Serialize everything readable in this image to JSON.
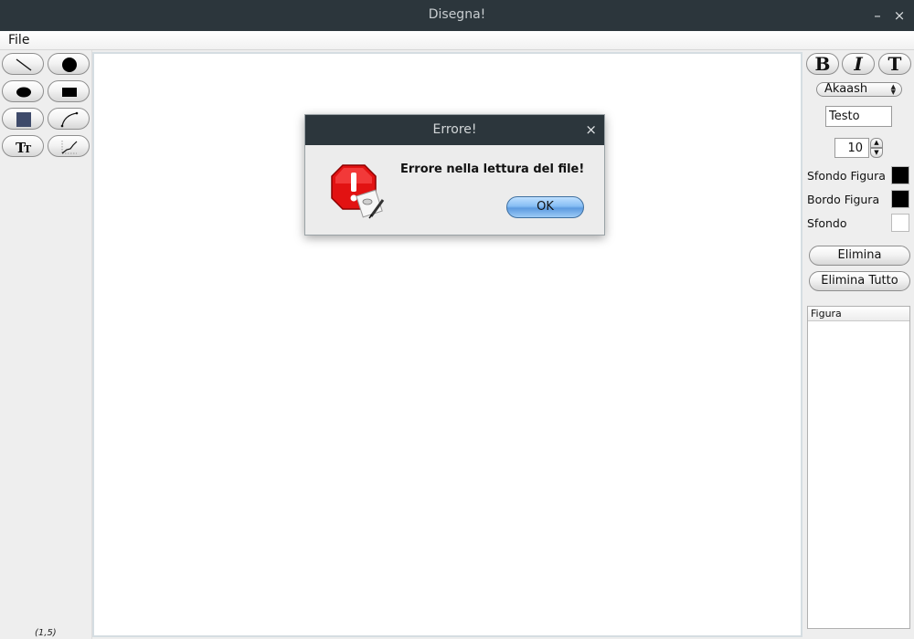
{
  "window": {
    "title": "Disegna!",
    "minimize_label": "–",
    "close_label": "×"
  },
  "menubar": {
    "items": [
      {
        "label": "File"
      }
    ]
  },
  "left_toolbar": {
    "tools": [
      {
        "name": "line-tool",
        "icon": "line-icon"
      },
      {
        "name": "circle-tool",
        "icon": "filled-circle-icon"
      },
      {
        "name": "ellipse-tool",
        "icon": "filled-ellipse-icon"
      },
      {
        "name": "rectangle-tool",
        "icon": "filled-rectangle-icon"
      },
      {
        "name": "square-tool",
        "icon": "filled-square-icon"
      },
      {
        "name": "curve-tool",
        "icon": "curve-icon"
      },
      {
        "name": "text-tool",
        "icon": "text-size-icon"
      },
      {
        "name": "polyline-tool",
        "icon": "polyline-icon"
      }
    ],
    "coordinates": "(1,5)"
  },
  "right_panel": {
    "bold_label": "B",
    "italic_label": "I",
    "text_label": "T",
    "font_name": "Akaash",
    "text_value": "Testo",
    "font_size": "10",
    "colors": [
      {
        "label": "Sfondo Figura",
        "color": "#000000"
      },
      {
        "label": "Bordo Figura",
        "color": "#000000"
      },
      {
        "label": "Sfondo",
        "color": "#ffffff"
      }
    ],
    "delete_label": "Elimina",
    "delete_all_label": "Elimina Tutto",
    "list_header": "Figura"
  },
  "dialog": {
    "title": "Errore!",
    "close_label": "×",
    "message": "Errore nella lettura del file!",
    "ok_label": "OK",
    "icon": "error-stop-icon"
  }
}
